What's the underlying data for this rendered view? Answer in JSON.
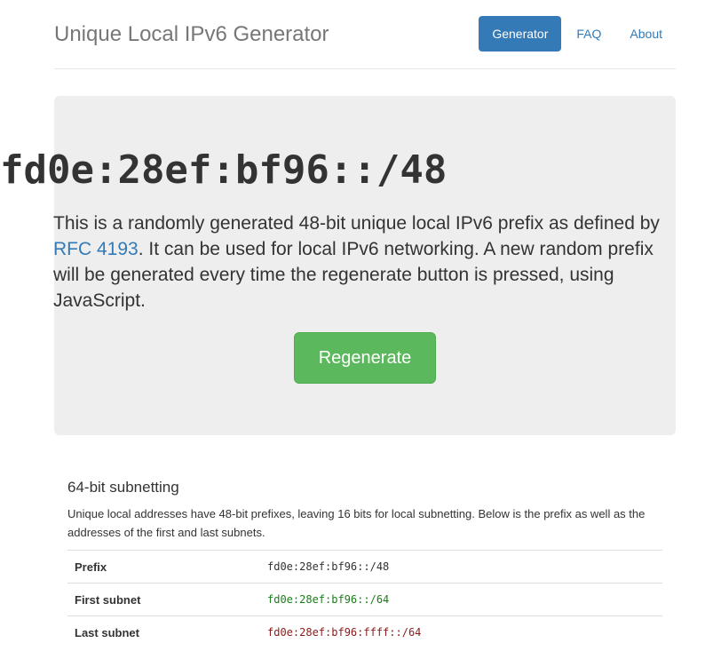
{
  "header": {
    "title": "Unique Local IPv6 Generator",
    "nav": [
      {
        "label": "Generator",
        "active": true
      },
      {
        "label": "FAQ",
        "active": false
      },
      {
        "label": "About",
        "active": false
      }
    ]
  },
  "hero": {
    "prefix": "fd0e:28ef:bf96::/48",
    "desc_before": "This is a randomly generated 48-bit unique local IPv6 prefix as defined by ",
    "rfc_link": "RFC 4193",
    "desc_after": ". It can be used for local IPv6 networking. A new random prefix will be generated every time the regenerate button is pressed, using JavaScript.",
    "button_label": "Regenerate"
  },
  "subnetting": {
    "heading": "64-bit subnetting",
    "description": "Unique local addresses have 48-bit prefixes, leaving 16 bits for local subnetting. Below is the prefix as well as the addresses of the first and last subnets.",
    "rows": [
      {
        "label": "Prefix",
        "value": "fd0e:28ef:bf96::/48",
        "color": "#333333"
      },
      {
        "label": "First subnet",
        "value": "fd0e:28ef:bf96::/64",
        "color": "#1a7d1a"
      },
      {
        "label": "Last subnet",
        "value": "fd0e:28ef:bf96:ffff::/64",
        "color": "#8b1a1a"
      }
    ]
  },
  "colors": {
    "primary": "#337ab7",
    "success": "#5cb85c",
    "jumbotron_bg": "#eeeeee"
  }
}
